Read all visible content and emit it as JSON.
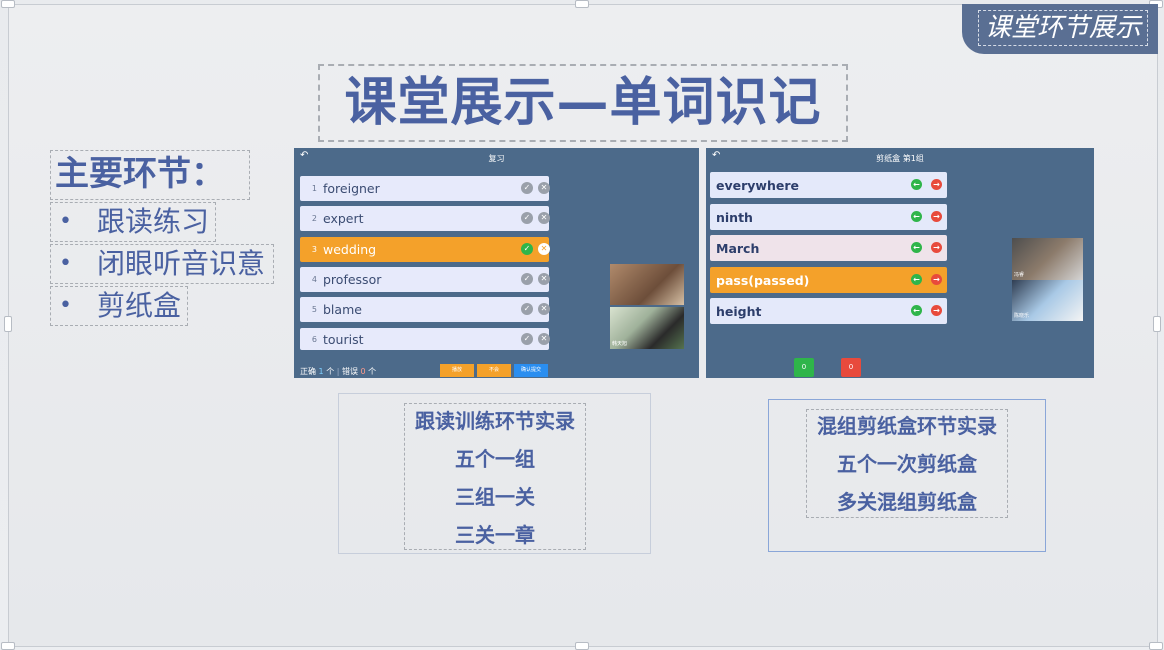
{
  "tab_label": "课堂环节展示",
  "title": "课堂展示—单词识记",
  "main": {
    "heading": "主要环节：",
    "bullets": [
      "跟读练习",
      "闭眼听音识意",
      "剪纸盒"
    ]
  },
  "panel1": {
    "title": "复习",
    "rows": [
      {
        "num": "1",
        "word": "foreigner"
      },
      {
        "num": "2",
        "word": "expert"
      },
      {
        "num": "3",
        "word": "wedding"
      },
      {
        "num": "4",
        "word": "professor"
      },
      {
        "num": "5",
        "word": "blame"
      },
      {
        "num": "6",
        "word": "tourist"
      }
    ],
    "footer": {
      "correct_label": "正确",
      "correct_count": "1",
      "unit1": "个",
      "wrong_label": "错误",
      "wrong_count": "0",
      "unit2": "个",
      "btn1": "播放",
      "btn2": "不会",
      "btn3": "确认提交"
    },
    "video2_label": "韩天旭"
  },
  "panel2": {
    "title": "剪纸盒 第1组",
    "rows": [
      "everywhere",
      "ninth",
      "March",
      "pass(passed)",
      "height"
    ],
    "counter_green": "0",
    "counter_red": "0",
    "video1_label": "冯睿",
    "video2_label": "陈晓乐"
  },
  "box1": {
    "lines": [
      "跟读训练环节实录",
      "五个一组",
      "三组一关",
      "三关一章"
    ]
  },
  "box2": {
    "lines": [
      "混组剪纸盒环节实录",
      "五个一次剪纸盒",
      "多关混组剪纸盒"
    ]
  },
  "colors": {
    "accent": "#4a61a1",
    "panel": "#4c6a8a",
    "selected": "#f4a12a"
  }
}
